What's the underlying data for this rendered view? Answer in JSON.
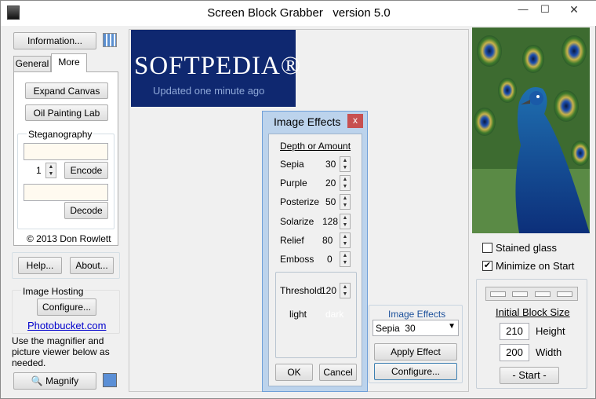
{
  "window": {
    "title": "Screen Block Grabber   version 5.0"
  },
  "left": {
    "information_label": "Information...",
    "tabs": [
      "General",
      "More"
    ],
    "expand_canvas_label": "Expand Canvas",
    "oil_painting_label": "Oil Painting Lab",
    "stego_title": "Steganography",
    "stego_input1": "",
    "stego_spin_value": "1",
    "encode_label": "Encode",
    "stego_input2": "",
    "decode_label": "Decode",
    "copyright": "© 2013 Don Rowlett",
    "help_label": "Help...",
    "about_label": "About...",
    "hosting_title": "Image Hosting",
    "configure_label": "Configure...",
    "photobucket_link": "Photobucket.com",
    "magnifier_note": "Use the magnifier and picture viewer below as needed.",
    "magnify_label": "Magnify"
  },
  "banner": {
    "logo": "SOFTPEDIA®",
    "subtitle": "Updated one minute ago"
  },
  "effects_dialog": {
    "title": "Image Effects",
    "heading": "Depth or Amount",
    "rows": [
      {
        "label": "Sepia",
        "value": "30"
      },
      {
        "label": "Purple",
        "value": "20"
      },
      {
        "label": "Posterize",
        "value": "50"
      },
      {
        "label": "Solarize",
        "value": "128"
      },
      {
        "label": "Relief",
        "value": "80"
      },
      {
        "label": "Emboss",
        "value": "0"
      }
    ],
    "threshold_label": "Threshold",
    "threshold_value": "120",
    "light_label": "light",
    "dark_label": "dark",
    "ok_label": "OK",
    "cancel_label": "Cancel"
  },
  "effects_panel": {
    "title": "Image Effects",
    "select_value": "Sepia  30",
    "apply_label": "Apply Effect",
    "configure_label": "Configure..."
  },
  "right": {
    "stained_glass_label": "Stained glass",
    "stained_glass_checked": false,
    "minimize_label": "Minimize on Start",
    "minimize_checked": true,
    "block_size_title": "Initial Block Size",
    "height_value": "210",
    "height_label": "Height",
    "width_value": "200",
    "width_label": "Width",
    "start_label": "- Start -"
  },
  "colors": {
    "accent": "#1a4f9a",
    "banner": "#0f2870",
    "link": "#0000cc"
  }
}
